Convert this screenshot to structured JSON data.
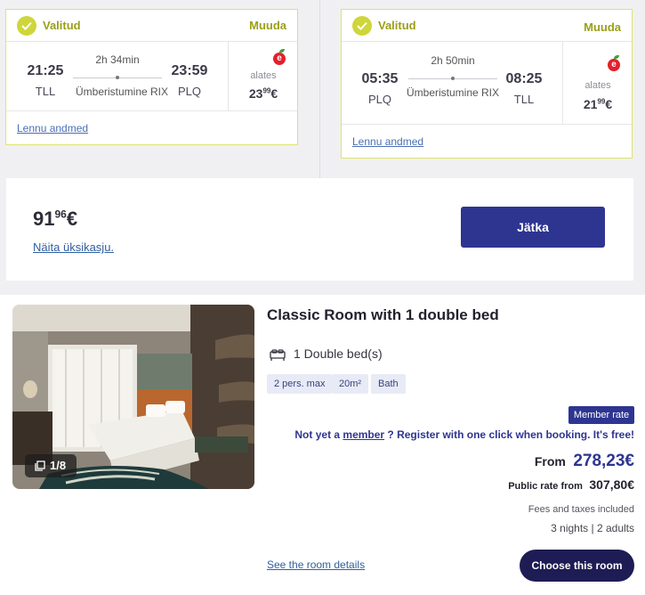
{
  "flights": [
    {
      "status": "Valitud",
      "change": "Muuda",
      "depart_time": "21:25",
      "depart_code": "TLL",
      "duration": "2h 34min",
      "transfer": "Ümberistumine RIX",
      "arrive_time": "23:59",
      "arrive_code": "PLQ",
      "from_label": "alates",
      "price_main": "23",
      "price_cents": "99",
      "price_currency": "€",
      "details_link": "Lennu andmed"
    },
    {
      "status": "Valitud",
      "change": "Muuda",
      "depart_time": "05:35",
      "depart_code": "PLQ",
      "duration": "2h 50min",
      "transfer": "Ümberistumine RIX",
      "arrive_time": "08:25",
      "arrive_code": "TLL",
      "from_label": "alates",
      "price_main": "21",
      "price_cents": "99",
      "price_currency": "€",
      "details_link": "Lennu andmed"
    }
  ],
  "summary": {
    "total_main": "91",
    "total_cents": "96",
    "currency": "€",
    "breakdown_link": "Näita üksikasju.",
    "continue_label": "Jätka"
  },
  "room": {
    "title": "Classic Room with 1 double bed",
    "photo_count": "1/8",
    "bed": "1 Double bed(s)",
    "tags": [
      "2 pers. max",
      "20m²",
      "Bath"
    ],
    "member_badge": "Member rate",
    "promo_prefix": "Not yet a ",
    "promo_link": "member",
    "promo_suffix": " ? Register with one click when booking. It's free!",
    "from_word": "From",
    "member_price": "278,23€",
    "public_label": "Public rate from",
    "public_price": "307,80€",
    "fees_note": "Fees and taxes included",
    "stay": "3 nights | 2 adults",
    "details_link": "See the room details",
    "choose_label": "Choose this room"
  },
  "colors": {
    "accent_yellow": "#cfd63a",
    "brand_navy": "#2e3591",
    "button_dark": "#1e1c54",
    "link_blue": "#2f5fa0"
  }
}
